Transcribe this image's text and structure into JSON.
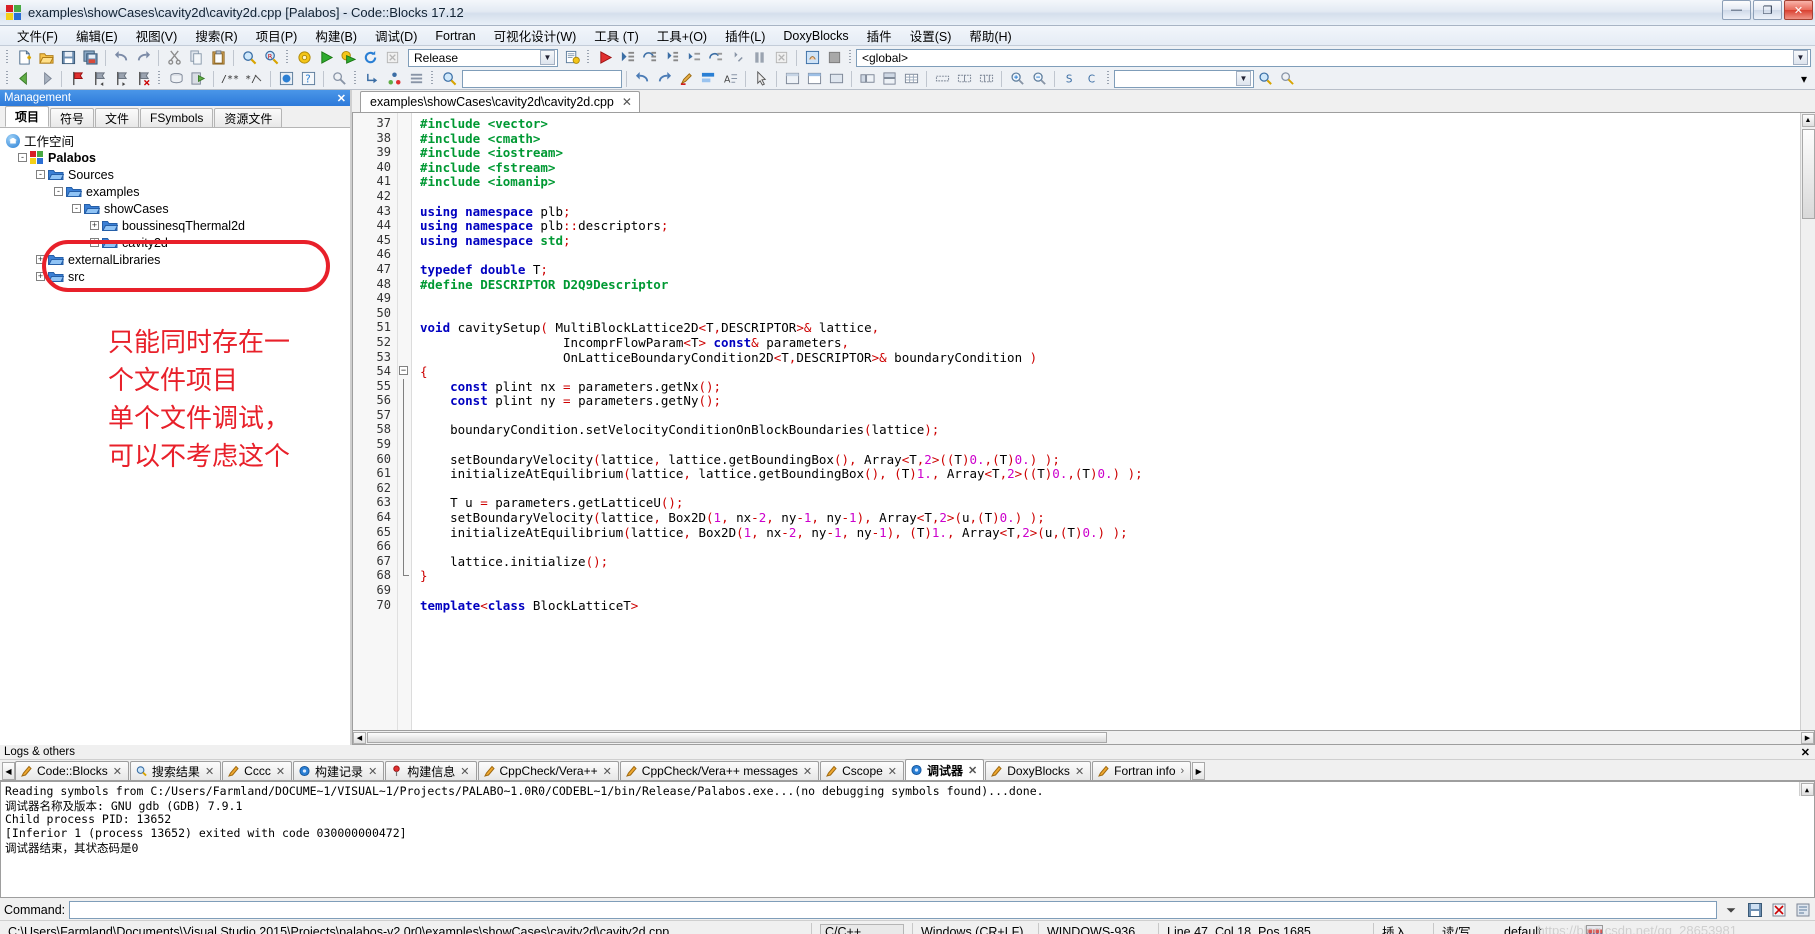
{
  "window": {
    "title": "examples\\showCases\\cavity2d\\cavity2d.cpp [Palabos] - Code::Blocks 17.12",
    "minimize": "—",
    "maximize": "❐",
    "close": "✕"
  },
  "menubar": {
    "items": [
      {
        "label": "文件(F)"
      },
      {
        "label": "编辑(E)"
      },
      {
        "label": "视图(V)"
      },
      {
        "label": "搜索(R)"
      },
      {
        "label": "项目(P)"
      },
      {
        "label": "构建(B)"
      },
      {
        "label": "调试(D)"
      },
      {
        "label": "Fortran"
      },
      {
        "label": "可视化设计(W)"
      },
      {
        "label": "工具 (T)"
      },
      {
        "label": "工具+(O)"
      },
      {
        "label": "插件(L)"
      },
      {
        "label": "DoxyBlocks"
      },
      {
        "label": "插件"
      },
      {
        "label": "设置(S)"
      },
      {
        "label": "帮助(H)"
      }
    ]
  },
  "toolbar": {
    "build_target": "Release",
    "scope": "<global>",
    "search_placeholder": "",
    "search_value": "",
    "goto_value": ""
  },
  "management": {
    "title": "Management",
    "close_label": "✕",
    "tabs": [
      {
        "label": "项目",
        "active": true
      },
      {
        "label": "符号",
        "active": false
      },
      {
        "label": "文件",
        "active": false
      },
      {
        "label": "FSymbols",
        "active": false
      },
      {
        "label": "资源文件",
        "active": false
      }
    ],
    "tree": [
      {
        "label": "工作空间",
        "depth": 0,
        "expander": "",
        "icon": "workspace-icon"
      },
      {
        "label": "Palabos",
        "depth": 1,
        "expander": "-",
        "icon": "project-icon",
        "bold": true
      },
      {
        "label": "Sources",
        "depth": 2,
        "expander": "-",
        "icon": "folder-open-icon"
      },
      {
        "label": "examples",
        "depth": 3,
        "expander": "-",
        "icon": "folder-open-icon"
      },
      {
        "label": "showCases",
        "depth": 4,
        "expander": "-",
        "icon": "folder-open-icon"
      },
      {
        "label": "boussinesqThermal2d",
        "depth": 5,
        "expander": "+",
        "icon": "folder-open-icon"
      },
      {
        "label": "cavity2d",
        "depth": 5,
        "expander": "+",
        "icon": "folder-open-icon"
      },
      {
        "label": "externalLibraries",
        "depth": 2,
        "expander": "+",
        "icon": "folder-open-icon"
      },
      {
        "label": "src",
        "depth": 2,
        "expander": "+",
        "icon": "folder-open-icon"
      }
    ],
    "annotation": {
      "color": "#e8202a",
      "lines": [
        "只能同时存在一",
        "个文件项目",
        "单个文件调试，",
        "可以不考虑这个"
      ]
    }
  },
  "editor": {
    "tab_label": "examples\\showCases\\cavity2d\\cavity2d.cpp",
    "tab_close": "✕",
    "first_line": 37,
    "lines": [
      {
        "n": 37,
        "html": "<span class='pp'>#include &lt;vector&gt;</span>"
      },
      {
        "n": 38,
        "html": "<span class='pp'>#include &lt;cmath&gt;</span>"
      },
      {
        "n": 39,
        "html": "<span class='pp'>#include &lt;iostream&gt;</span>"
      },
      {
        "n": 40,
        "html": "<span class='pp'>#include &lt;fstream&gt;</span>"
      },
      {
        "n": 41,
        "html": "<span class='pp'>#include &lt;iomanip&gt;</span>"
      },
      {
        "n": 42,
        "html": ""
      },
      {
        "n": 43,
        "html": "<span class='kw'>using namespace</span> plb<span class='op'>;</span>"
      },
      {
        "n": 44,
        "html": "<span class='kw'>using namespace</span> plb<span class='op'>::</span>descriptors<span class='op'>;</span>"
      },
      {
        "n": 45,
        "html": "<span class='kw'>using namespace</span> <span class='pp'>std</span><span class='op'>;</span>"
      },
      {
        "n": 46,
        "html": ""
      },
      {
        "n": 47,
        "html": "<span class='kw'>typedef double</span> T<span class='op'>;</span>"
      },
      {
        "n": 48,
        "html": "<span class='pp'>#define DESCRIPTOR D2Q9Descriptor</span>"
      },
      {
        "n": 49,
        "html": ""
      },
      {
        "n": 50,
        "html": ""
      },
      {
        "n": 51,
        "html": "<span class='kw'>void</span> cavitySetup<span class='br'>(</span> MultiBlockLattice2D<span class='op'>&lt;</span>T<span class='op'>,</span>DESCRIPTOR<span class='op'>&gt;&amp;</span> lattice<span class='op'>,</span>"
      },
      {
        "n": 52,
        "html": "                   IncomprFlowParam<span class='op'>&lt;</span>T<span class='op'>&gt;</span> <span class='kw'>const</span><span class='op'>&amp;</span> parameters<span class='op'>,</span>"
      },
      {
        "n": 53,
        "html": "                   OnLatticeBoundaryCondition2D<span class='op'>&lt;</span>T<span class='op'>,</span>DESCRIPTOR<span class='op'>&gt;&amp;</span> boundaryCondition <span class='br'>)</span>"
      },
      {
        "n": 54,
        "html": "<span class='br'>{</span>"
      },
      {
        "n": 55,
        "html": "    <span class='kw'>const</span> plint nx <span class='op'>=</span> parameters.getNx<span class='br'>()</span><span class='op'>;</span>"
      },
      {
        "n": 56,
        "html": "    <span class='kw'>const</span> plint ny <span class='op'>=</span> parameters.getNy<span class='br'>()</span><span class='op'>;</span>"
      },
      {
        "n": 57,
        "html": ""
      },
      {
        "n": 58,
        "html": "    boundaryCondition.setVelocityConditionOnBlockBoundaries<span class='br'>(</span>lattice<span class='br'>)</span><span class='op'>;</span>"
      },
      {
        "n": 59,
        "html": ""
      },
      {
        "n": 60,
        "html": "    setBoundaryVelocity<span class='br'>(</span>lattice<span class='op'>,</span> lattice.getBoundingBox<span class='br'>()</span><span class='op'>,</span> Array<span class='op'>&lt;</span>T<span class='op'>,</span><span class='num'>2</span><span class='op'>&gt;</span><span class='br'>((</span>T<span class='br'>)</span><span class='num'>0.</span><span class='op'>,</span><span class='br'>(</span>T<span class='br'>)</span><span class='num'>0.</span><span class='br'>)</span> <span class='br'>)</span><span class='op'>;</span>"
      },
      {
        "n": 61,
        "html": "    initializeAtEquilibrium<span class='br'>(</span>lattice<span class='op'>,</span> lattice.getBoundingBox<span class='br'>()</span><span class='op'>,</span> <span class='br'>(</span>T<span class='br'>)</span><span class='num'>1.</span><span class='op'>,</span> Array<span class='op'>&lt;</span>T<span class='op'>,</span><span class='num'>2</span><span class='op'>&gt;</span><span class='br'>((</span>T<span class='br'>)</span><span class='num'>0.</span><span class='op'>,</span><span class='br'>(</span>T<span class='br'>)</span><span class='num'>0.</span><span class='br'>)</span> <span class='br'>)</span><span class='op'>;</span>"
      },
      {
        "n": 62,
        "html": ""
      },
      {
        "n": 63,
        "html": "    T u <span class='op'>=</span> parameters.getLatticeU<span class='br'>()</span><span class='op'>;</span>"
      },
      {
        "n": 64,
        "html": "    setBoundaryVelocity<span class='br'>(</span>lattice<span class='op'>,</span> Box2D<span class='br'>(</span><span class='num'>1</span><span class='op'>,</span> nx<span class='op'>-</span><span class='num'>2</span><span class='op'>,</span> ny<span class='op'>-</span><span class='num'>1</span><span class='op'>,</span> ny<span class='op'>-</span><span class='num'>1</span><span class='br'>)</span><span class='op'>,</span> Array<span class='op'>&lt;</span>T<span class='op'>,</span><span class='num'>2</span><span class='op'>&gt;</span><span class='br'>(</span>u<span class='op'>,</span><span class='br'>(</span>T<span class='br'>)</span><span class='num'>0.</span><span class='br'>)</span> <span class='br'>)</span><span class='op'>;</span>"
      },
      {
        "n": 65,
        "html": "    initializeAtEquilibrium<span class='br'>(</span>lattice<span class='op'>,</span> Box2D<span class='br'>(</span><span class='num'>1</span><span class='op'>,</span> nx<span class='op'>-</span><span class='num'>2</span><span class='op'>,</span> ny<span class='op'>-</span><span class='num'>1</span><span class='op'>,</span> ny<span class='op'>-</span><span class='num'>1</span><span class='br'>)</span><span class='op'>,</span> <span class='br'>(</span>T<span class='br'>)</span><span class='num'>1.</span><span class='op'>,</span> Array<span class='op'>&lt;</span>T<span class='op'>,</span><span class='num'>2</span><span class='op'>&gt;</span><span class='br'>(</span>u<span class='op'>,</span><span class='br'>(</span>T<span class='br'>)</span><span class='num'>0.</span><span class='br'>)</span> <span class='br'>)</span><span class='op'>;</span>"
      },
      {
        "n": 66,
        "html": ""
      },
      {
        "n": 67,
        "html": "    lattice.initialize<span class='br'>()</span><span class='op'>;</span>"
      },
      {
        "n": 68,
        "html": "<span class='br'>}</span>"
      },
      {
        "n": 69,
        "html": ""
      },
      {
        "n": 70,
        "html": "<span class='kw'>template</span><span class='op'>&lt;</span><span class='kw'>class</span> BlockLatticeT<span class='op'>&gt;</span>"
      }
    ]
  },
  "logs": {
    "title": "Logs & others",
    "close_label": "✕",
    "nav_left": "◀",
    "nav_right": "▶",
    "tabs": [
      {
        "label": "Code::Blocks",
        "icon": "pencil-icon",
        "active": false
      },
      {
        "label": "搜索结果",
        "icon": "search-icon",
        "active": false
      },
      {
        "label": "Cccc",
        "icon": "pencil-icon",
        "active": false
      },
      {
        "label": "构建记录",
        "icon": "gear-blue-icon",
        "active": false
      },
      {
        "label": "构建信息",
        "icon": "pin-icon",
        "active": false
      },
      {
        "label": "CppCheck/Vera++",
        "icon": "pencil-icon",
        "active": false
      },
      {
        "label": "CppCheck/Vera++ messages",
        "icon": "pencil-icon",
        "active": false
      },
      {
        "label": "Cscope",
        "icon": "pencil-icon",
        "active": false
      },
      {
        "label": "调试器",
        "icon": "gear-blue-icon",
        "active": true
      },
      {
        "label": "DoxyBlocks",
        "icon": "pencil-icon",
        "active": false
      },
      {
        "label": "Fortran info",
        "icon": "pencil-icon",
        "active": false
      }
    ],
    "content": [
      "Reading symbols from C:/Users/Farmland/DOCUME~1/VISUAL~1/Projects/PALABO~1.0R0/CODEBL~1/bin/Release/Palabos.exe...(no debugging symbols found)...done.",
      "调试器名称及版本: GNU gdb (GDB) 7.9.1",
      "Child process PID: 13652",
      "[Inferior 1 (process 13652) exited with code 030000000472]",
      "调试器结束，其状态码是0"
    ],
    "command_label": "Command:",
    "command_value": ""
  },
  "statusbar": {
    "path": "C:\\Users\\Farmland\\Documents\\Visual Studio 2015\\Projects\\palabos-v2.0r0\\examples\\showCases\\cavity2d\\cavity2d.cpp",
    "language": "C/C++",
    "line_ending": "Windows (CR+LF)",
    "encoding": "WINDOWS-936",
    "caret": "Line 47, Col 18, Pos 1685",
    "insert_mode": "插入",
    "readwrite": "读/写",
    "profile": "default",
    "watermark": "https://blog.csdn.net/qq_28653981"
  },
  "colors": {
    "accent": "#2d7ada",
    "annotation": "#e8202a",
    "keyword": "#0000c0",
    "preprocessor": "#009933",
    "operator": "#cc0000",
    "number": "#cc00cc"
  }
}
